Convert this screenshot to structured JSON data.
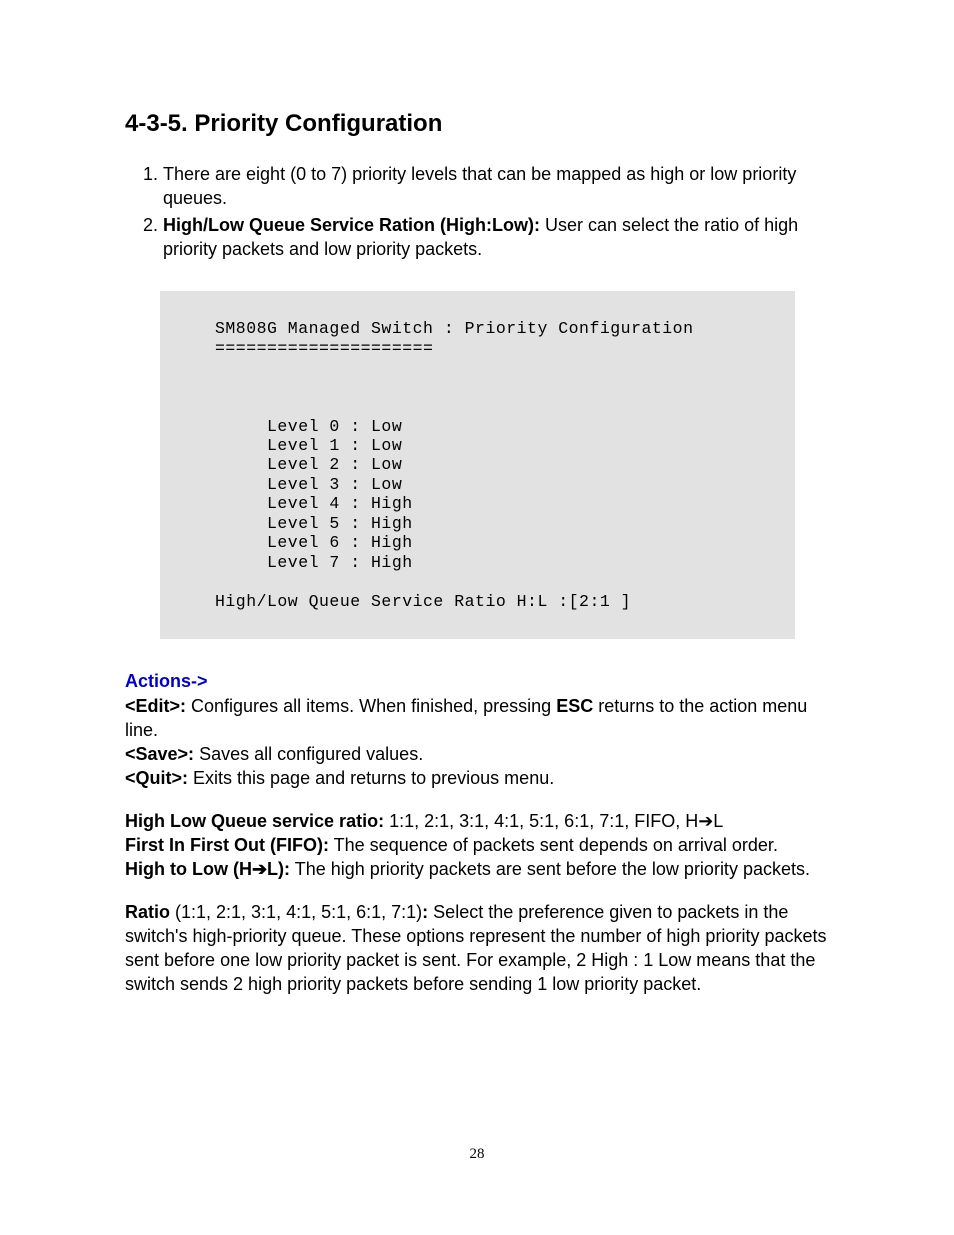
{
  "title": "4-3-5. Priority Configuration",
  "list": {
    "item1": "There are eight (0 to 7) priority levels that can be mapped as high or low priority queues.",
    "item2_bold": "High/Low Queue Service Ration (High:Low):",
    "item2_rest": " User can select the ratio of high priority packets and low priority packets."
  },
  "terminal": {
    "line1": "SM808G Managed Switch : Priority Configuration",
    "line2": "=====================",
    "levels": [
      "     Level 0 : Low",
      "     Level 1 : Low",
      "     Level 2 : Low",
      "     Level 3 : Low",
      "     Level 4 : High",
      "     Level 5 : High",
      "     Level 6 : High",
      "     Level 7 : High"
    ],
    "ratio_line": "High/Low Queue Service Ratio H:L :[2:1 ]"
  },
  "actions": {
    "label": "Actions->",
    "edit_b": "<Edit>:",
    "edit_t1": " Configures all items. When finished, pressing ",
    "edit_esc": "ESC",
    "edit_t2": " returns to the action menu line.",
    "save_b": "<Save>:",
    "save_t": " Saves all configured values.",
    "quit_b": "<Quit>:",
    "quit_t": " Exits this page and returns to previous menu."
  },
  "hlq": {
    "b1": "High Low Queue service ratio:",
    "t1": " 1:1, 2:1, 3:1, 4:1, 5:1, 6:1, 7:1, FIFO, H➔L",
    "b2": "First In First Out (FIFO):",
    "t2": " The sequence of packets sent depends on arrival order.",
    "b3": "High to Low (H➔L):",
    "t3": " The high priority packets are sent before the low priority packets."
  },
  "ratio": {
    "b1": "Ratio",
    "paren": " (1:1, 2:1, 3:1, 4:1, 5:1, 6:1, 7:1)",
    "colon": ":",
    "text": " Select the preference given to packets in the switch's high-priority queue. These options represent the number of high priority packets sent before one low priority packet is sent. For example, 2 High : 1 Low means that the switch sends 2 high priority packets before sending 1 low priority packet."
  },
  "page_number": "28"
}
